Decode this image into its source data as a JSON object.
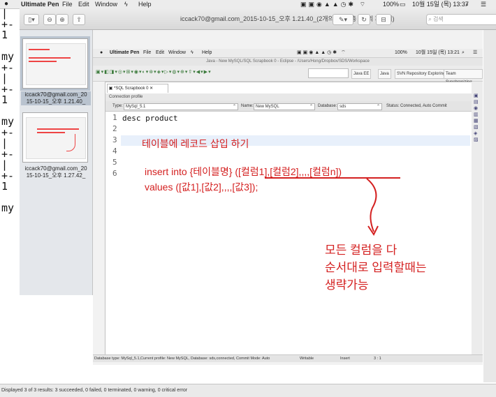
{
  "menubar": {
    "app": "Ultimate Pen",
    "menus": [
      "File",
      "Edit",
      "Window",
      "Help"
    ],
    "battery": "100%",
    "datetime": "10월 15일 (목) 13:37"
  },
  "terminal_lines": [
    "|",
    "+-",
    "1",
    "",
    "my",
    "+-",
    "|",
    "+-",
    "1",
    "",
    "my",
    "+-",
    "|",
    "+-",
    "|",
    "+-",
    "1",
    "",
    "my"
  ],
  "preview": {
    "window_title": "iccack70@gmail.com_2015-10-15_오후 1.21.40_(2개의 문서, 총 2장의 페이지)",
    "search_placeholder": "검색",
    "thumbs": [
      {
        "caption1": "iccack70@gmail.com_20",
        "caption2": "15-10-15_오후 1.21.40_"
      },
      {
        "caption1": "iccack70@gmail.com_20",
        "caption2": "15-10-15_오후 1.27.42_"
      }
    ],
    "status": "Displayed 3 of 3 results: 3 succeeded, 0 failed, 0 terminated, 0 warning, 0 critical error"
  },
  "inner": {
    "menubar": {
      "app": "Ultimate Pen",
      "menus": [
        "File",
        "Edit",
        "Window",
        "Help"
      ],
      "battery": "100%",
      "datetime": "10월 15일 (목) 13:21"
    },
    "eclipse_title": "Java - New MySQL/SQL Scrapbook 0 - Eclipse - /Users/Hong/Dropbox/SDS/Workspace",
    "perspectives": [
      "Java EE",
      "Java",
      "SVN Repository Exploring",
      "Team Synchronizing"
    ],
    "editor_tab": "*SQL Scrapbook 0",
    "connection_profile_label": "Connection profile",
    "type_label": "Type:",
    "type_value": "MySql_5.1",
    "name_label": "Name:",
    "name_value": "New MySQL",
    "db_label": "Database:",
    "db_value": "sds",
    "status_label": "Status:",
    "status_value": "Connected, Auto Commit",
    "line_numbers": [
      "1",
      "2",
      "3",
      "4",
      "5",
      "6"
    ],
    "code_line1": "desc product",
    "annotation_title": "테이블에 레코드 삽입 하기",
    "annotation_insert": "insert into {테이블명} ([컬럼1],[컬럼2],,,,[컬럼n])",
    "annotation_values": "values ([값1],[값2],,,,[값3]);",
    "annotation_note1": "모든 컬럼을 다",
    "annotation_note2": "순서대로 입력할때는",
    "annotation_note3": "생략가능",
    "annotation_color": "#d42020",
    "statusbar_text": "Database type: MySql_5.1,Current profile: New MySQL, Database: sds,connected, Commit Mode: Auto",
    "statusbar_writable": "Writable",
    "statusbar_insert": "Insert",
    "statusbar_pos": "3 : 1"
  }
}
